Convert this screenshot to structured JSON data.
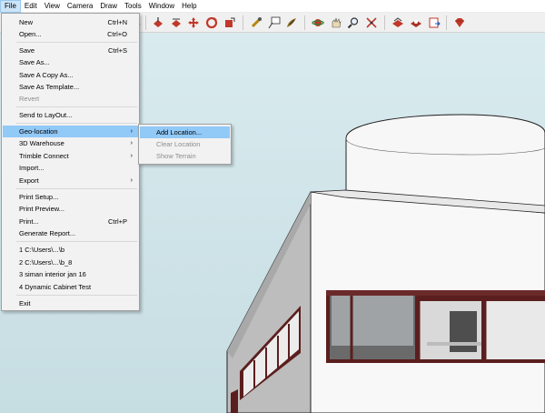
{
  "menubar": {
    "items": [
      "File",
      "Edit",
      "View",
      "Camera",
      "Draw",
      "Tools",
      "Window",
      "Help"
    ]
  },
  "toolbar": {
    "icons": [
      "bucket-icon",
      "push-pull-icon",
      "move-icon",
      "rotate-icon",
      "scale-icon",
      "tape-measure-icon",
      "text-label-icon",
      "paint-icon",
      "orbit-icon",
      "pan-icon",
      "zoom-icon",
      "zoom-extents-icon",
      "3d-warehouse-icon",
      "extension-warehouse-icon",
      "send-to-layout-icon",
      "ruby-console-icon"
    ]
  },
  "file_menu": {
    "new": {
      "label": "New",
      "shortcut": "Ctrl+N"
    },
    "open": {
      "label": "Open...",
      "shortcut": "Ctrl+O"
    },
    "save": {
      "label": "Save",
      "shortcut": "Ctrl+S"
    },
    "save_as": {
      "label": "Save As..."
    },
    "save_copy_as": {
      "label": "Save A Copy As..."
    },
    "save_as_template": {
      "label": "Save As Template..."
    },
    "revert": {
      "label": "Revert"
    },
    "send_to_layout": {
      "label": "Send to LayOut..."
    },
    "geo_location": {
      "label": "Geo-location",
      "arrow": "›"
    },
    "warehouse": {
      "label": "3D Warehouse",
      "arrow": "›"
    },
    "trimble_connect": {
      "label": "Trimble Connect",
      "arrow": "›"
    },
    "import": {
      "label": "Import..."
    },
    "export": {
      "label": "Export",
      "arrow": "›"
    },
    "print_setup": {
      "label": "Print Setup..."
    },
    "print_preview": {
      "label": "Print Preview..."
    },
    "print": {
      "label": "Print...",
      "shortcut": "Ctrl+P"
    },
    "generate_report": {
      "label": "Generate Report..."
    },
    "recent_1": {
      "label": "1 C:\\Users\\...\\b"
    },
    "recent_2": {
      "label": "2 C:\\Users\\...\\b_8"
    },
    "recent_3": {
      "label": "3 siman interior jan 16"
    },
    "recent_4": {
      "label": "4 Dynamic Cabinet Test"
    },
    "exit": {
      "label": "Exit"
    }
  },
  "geo_submenu": {
    "add_location": {
      "label": "Add Location..."
    },
    "clear_location": {
      "label": "Clear Location"
    },
    "show_terrain": {
      "label": "Show Terrain"
    }
  },
  "colors": {
    "menu_highlight": "#91c9f7",
    "menu_bg": "#f2f2f2",
    "sky": "#d2e6ea",
    "window_frame": "#6b2a2a"
  }
}
